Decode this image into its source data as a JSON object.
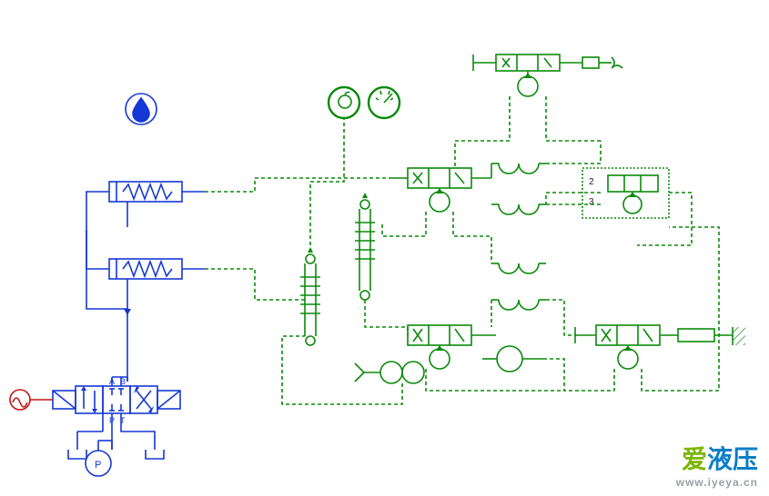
{
  "diagram": {
    "ports": {
      "A": "A",
      "B": "B",
      "P": "P",
      "T": "T"
    },
    "labels": {
      "n2": "2",
      "n3": "3"
    },
    "icons": {
      "hydraulic_fluid": "hydraulic-fluid-drop",
      "apple": "apple-stamp",
      "gauge": "gauge-stamp"
    },
    "colors": {
      "hydraulic": "#1537d6",
      "pneumatic": "#0a8a0a",
      "signal": "#c21313",
      "dashed": "#0a8a0a"
    }
  },
  "watermark": {
    "brand_cn_1": "爱",
    "brand_cn_2": "液压",
    "url": "www.iyeya.cn"
  }
}
